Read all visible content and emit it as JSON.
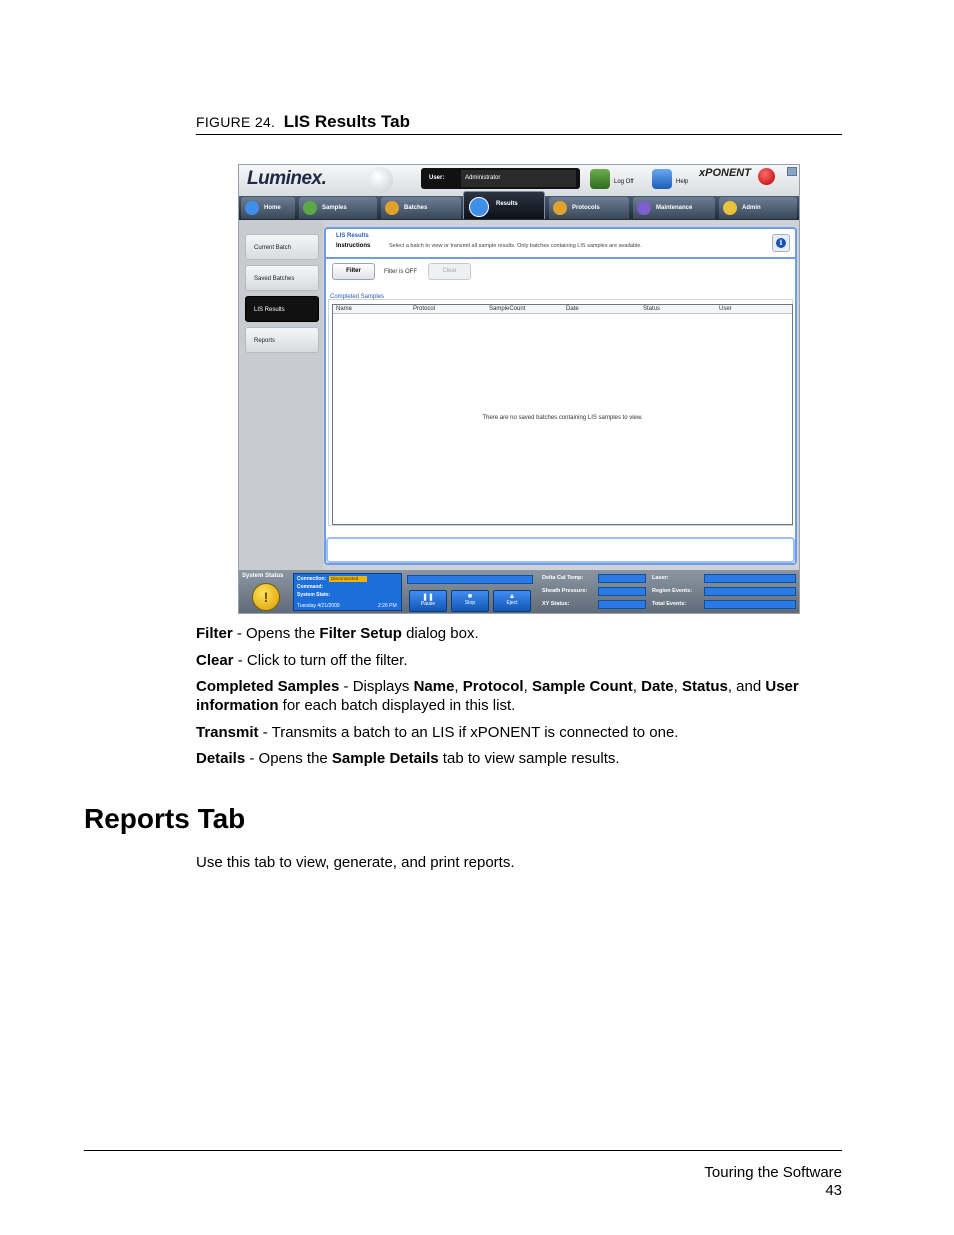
{
  "figure": {
    "number": "FIGURE 24.",
    "title": "LIS Results Tab"
  },
  "app": {
    "logo": "Luminex.",
    "brand": "xPONENT",
    "user_label": "User:",
    "user_value": "Administrator",
    "logoff_label": "Log Off",
    "help_label": "Help",
    "nav_tabs": [
      "Home",
      "Samples",
      "Batches",
      "Results",
      "Protocols",
      "Maintenance",
      "Admin"
    ],
    "sidebar": [
      "Current Batch",
      "Saved Batches",
      "LIS Results",
      "Reports"
    ],
    "crumb": "LIS Results",
    "instructions_label": "Instructions",
    "instructions_text": "Select a batch to view or transmit all sample results. Only batches containing LIS samples are available.",
    "filter_label": "Filter",
    "filter_state": "Filter is OFF",
    "clear_label": "Clear",
    "completed_samples": "Completed Samples",
    "columns": [
      "Name",
      "Protocol",
      "SampleCount",
      "Date",
      "Status",
      "User"
    ],
    "empty_message": "There are no saved batches containing LIS samples to view.",
    "status": {
      "system_status": "System Status",
      "connection": "Connection:",
      "connection_state": "Disconnected",
      "command": "Command:",
      "system_state": "System State:",
      "date": "Tuesday 4/21/2009",
      "time": "2:26 PM",
      "buttons": [
        "Pause",
        "Stop",
        "Eject"
      ],
      "stats_left": [
        "Delta Cal Temp:",
        "Sheath Pressure:",
        "XY Status:"
      ],
      "stats_right": [
        "Laser:",
        "Region Events:",
        "Total Events:"
      ]
    }
  },
  "descriptions": {
    "filter": {
      "term": "Filter",
      "text1": " - Opens the ",
      "b1": "Filter Setup",
      "text2": " dialog box."
    },
    "clear": {
      "term": "Clear",
      "text1": " - Click to turn off the filter."
    },
    "completed": {
      "term": "Completed Samples",
      "text1": " - Displays ",
      "b1": "Name",
      "s1": ", ",
      "b2": "Protocol",
      "s2": ", ",
      "b3": "Sample Count",
      "s3": ", ",
      "b4": "Date",
      "s4": ", ",
      "b5": "Status",
      "s5": ", and ",
      "b6": "User information",
      "text2": " for each batch displayed in this list."
    },
    "transmit": {
      "term": "Transmit",
      "text1": " - Transmits a batch to an LIS if xPONENT is connected to one."
    },
    "details": {
      "term": "Details",
      "text1": " - Opens the ",
      "b1": "Sample Details",
      "text2": " tab to view sample results."
    }
  },
  "section": {
    "title": "Reports Tab",
    "body": "Use this tab to view, generate, and print reports."
  },
  "footer": {
    "chapter": "Touring the Software",
    "page": "43"
  }
}
